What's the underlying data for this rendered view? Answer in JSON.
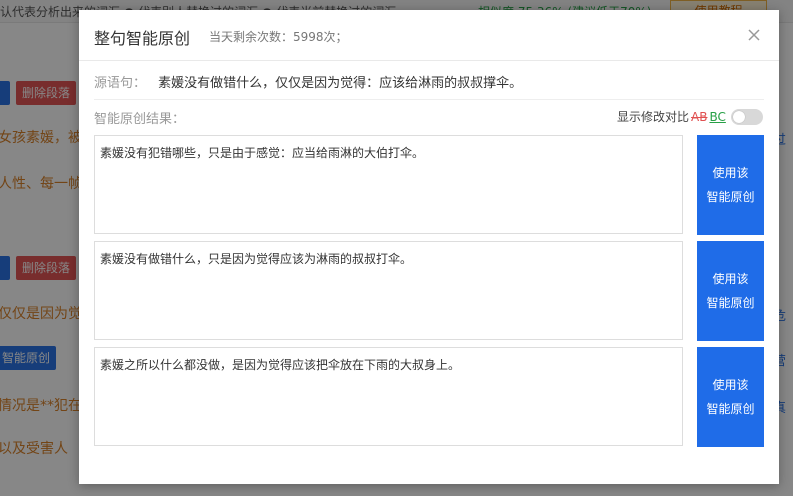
{
  "background": {
    "top_left_text": "认代表分析出来的词汇  ● 代表别人替换过的词汇  ● 代表当前替换过的词汇",
    "top_right_text": "相似度 75.36% (建议低于70%)",
    "tutorial_label": "使用教程",
    "delete_paragraph_label": "删除段落",
    "smart_original_label": "智能原创",
    "snippets": [
      "女孩素媛，被",
      "人性、每一帧",
      "仅仅是因为觉",
      "情况是**犯在",
      "以及受害人"
    ],
    "edge_snippets": [
      "过",
      "危",
      "营",
      "真"
    ]
  },
  "modal": {
    "title": "整句智能原创",
    "remaining": "当天剩余次数：5998次；",
    "source_label": "源语句：",
    "source_text": "素媛没有做错什么，仅仅是因为觉得：应该给淋雨的叔叔撑伞。",
    "result_label": "智能原创结果：",
    "diff_label": "显示修改对比",
    "diff_ab": "AB",
    "diff_bc": "BC",
    "results": [
      "素媛没有犯错哪些，只是由于感觉：应当给雨淋的大伯打伞。",
      "素媛没有做错什么，只是因为觉得应该为淋雨的叔叔打伞。",
      "素媛之所以什么都没做，是因为觉得应该把伞放在下雨的大叔身上。"
    ],
    "use_button_line1": "使用该",
    "use_button_line2": "智能原创"
  }
}
